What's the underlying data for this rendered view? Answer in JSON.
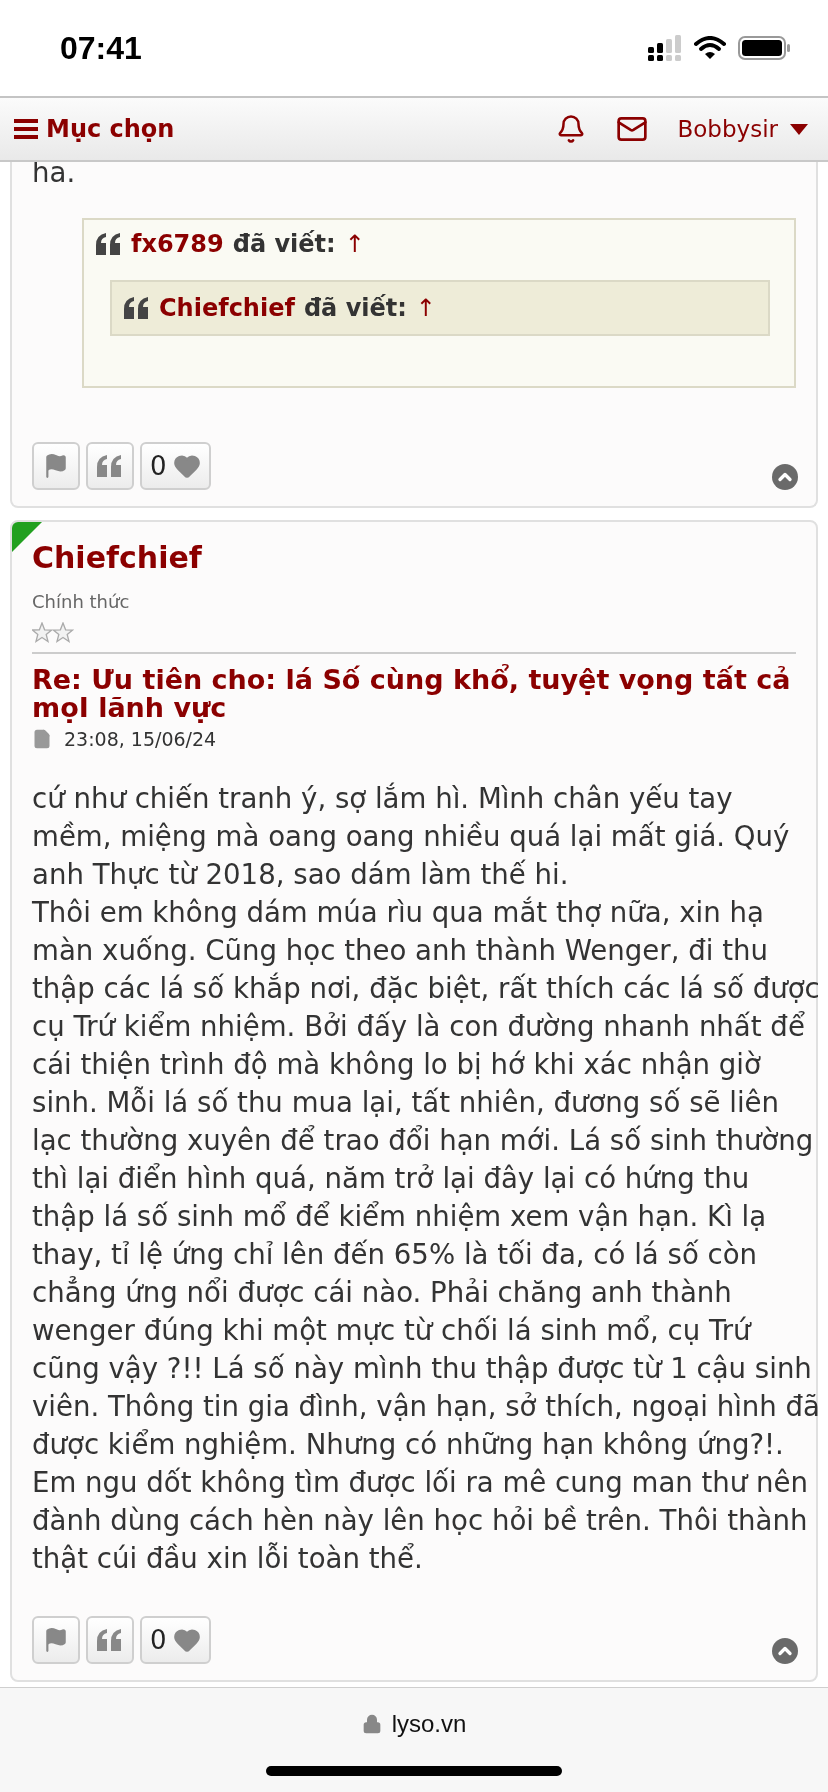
{
  "status_bar": {
    "time": "07:41"
  },
  "nav": {
    "menu_label": "Mục chọn",
    "user": "Bobbysir"
  },
  "posts": [
    {
      "online": false,
      "body": [
        "ha."
      ],
      "quote": {
        "author": "fx6789",
        "wrote": "đã viết:",
        "arrow": "↑",
        "children": [
          {
            "author": "Chiefchief",
            "wrote": "đã viết:",
            "arrow": "↑"
          }
        ]
      },
      "likes": "0"
    },
    {
      "online": true,
      "author": "Chiefchief",
      "rank": "Chính thức",
      "title": "Re: Ưu tiên cho: lá Số cùng khổ, tuyệt vọng tất cả mọI lãnh vực",
      "date": "23:08, 15/06/24",
      "body": [
        "cứ như chiến tranh ý, sợ lắm hì. Mình chân yếu tay mềm, miệng mà oang oang nhiều quá lại mất giá. Quý anh Thực từ 2018, sao dám làm thế hi.",
        "Thôi em không dám múa rìu qua mắt thợ nữa, xin hạ màn xuống. Cũng học theo anh thành Wenger, đi thu thập các lá số khắp nơi, đặc biệt, rất thích các lá số được cụ Trứ kiểm nhiệm. Bởi đấy là con đường nhanh nhất để cái thiện trình độ mà không lo bị hớ khi xác nhận giờ sinh. Mỗi lá số thu mua lại, tất nhiên, đương số sẽ liên lạc thường xuyên để trao đổi hạn mới. Lá số sinh thường thì lại điển hình quá, năm trở lại đây lại có hứng thu thập lá số sinh mổ để kiểm nhiệm xem vận hạn. Kì lạ thay, tỉ lệ ứng chỉ lên đến 65% là tối đa, có lá số còn chẳng ứng nổi được cái nào. Phải chăng anh thành wenger đúng khi một mực từ chối lá sinh mổ, cụ Trứ cũng vậy ?!! Lá số này mình thu thập được từ 1 cậu sinh viên. Thông tin gia đình, vận hạn, sở thích, ngoại hình đã được kiểm nghiệm. Nhưng có những hạn không ứng?!. Em ngu dốt không tìm được lối ra mê cung man thư nên đành dùng cách hèn này lên học hỏi bề trên. Thôi thành thật cúi đầu xin lỗi toàn thể."
      ],
      "likes": "0"
    }
  ],
  "browser_bar": {
    "url": "lyso.vn"
  }
}
